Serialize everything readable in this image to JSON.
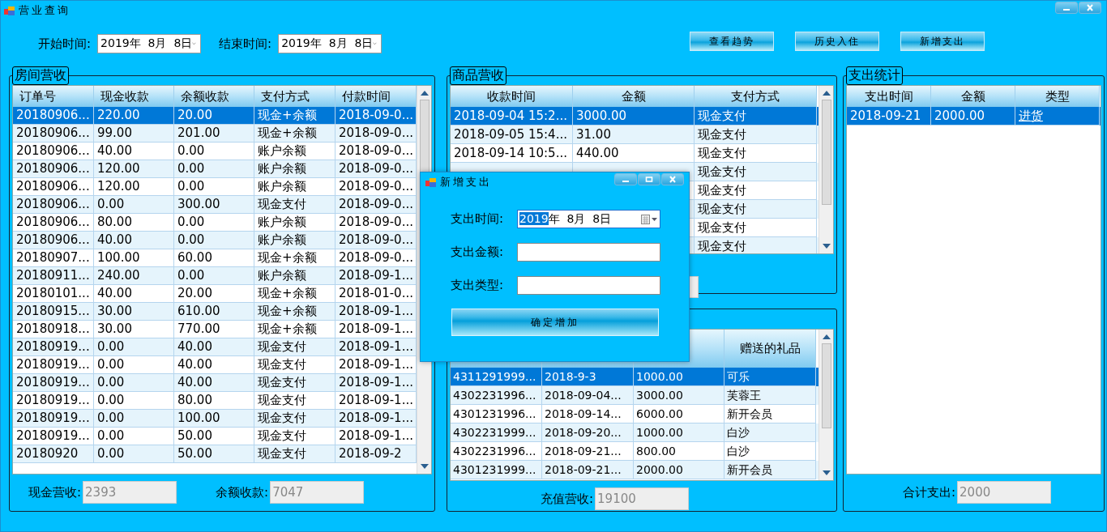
{
  "window": {
    "title": "营业查询"
  },
  "filters": [
    {
      "label": "开始时间:",
      "value": "2019年  8月  8日"
    },
    {
      "label": "结束时间:",
      "value": "2019年  8月  8日"
    }
  ],
  "buttons": [
    "查看趋势",
    "历史入住",
    "新增支出"
  ],
  "room_revenue": {
    "title": "房间营收",
    "columns": [
      "订单号",
      "现金收款",
      "余额收款",
      "支付方式",
      "付款时间"
    ],
    "rows": [
      {
        "cells": [
          "20180906...",
          "220.00",
          "20.00",
          "现金+余额",
          "2018-09-0..."
        ],
        "selected": true
      },
      {
        "cells": [
          "20180906...",
          "99.00",
          "201.00",
          "现金+余额",
          "2018-09-0..."
        ],
        "selected": false
      },
      {
        "cells": [
          "20180906...",
          "40.00",
          "0.00",
          "账户余额",
          "2018-09-0..."
        ],
        "selected": false
      },
      {
        "cells": [
          "20180906...",
          "120.00",
          "0.00",
          "账户余额",
          "2018-09-0..."
        ],
        "selected": false
      },
      {
        "cells": [
          "20180906...",
          "120.00",
          "0.00",
          "账户余额",
          "2018-09-0..."
        ],
        "selected": false
      },
      {
        "cells": [
          "20180906...",
          "0.00",
          "300.00",
          "现金支付",
          "2018-09-0..."
        ],
        "selected": false
      },
      {
        "cells": [
          "20180906...",
          "80.00",
          "0.00",
          "账户余额",
          "2018-09-0..."
        ],
        "selected": false
      },
      {
        "cells": [
          "20180906...",
          "40.00",
          "0.00",
          "账户余额",
          "2018-09-0..."
        ],
        "selected": false
      },
      {
        "cells": [
          "20180907...",
          "100.00",
          "60.00",
          "现金+余额",
          "2018-09-0..."
        ],
        "selected": false
      },
      {
        "cells": [
          "20180911...",
          "240.00",
          "0.00",
          "账户余额",
          "2018-09-1..."
        ],
        "selected": false
      },
      {
        "cells": [
          "20180101...",
          "40.00",
          "20.00",
          "现金+余额",
          "2018-01-0..."
        ],
        "selected": false
      },
      {
        "cells": [
          "20180915...",
          "30.00",
          "610.00",
          "现金+余额",
          "2018-09-1..."
        ],
        "selected": false
      },
      {
        "cells": [
          "20180918...",
          "30.00",
          "770.00",
          "现金+余额",
          "2018-09-1..."
        ],
        "selected": false
      },
      {
        "cells": [
          "20180919...",
          "0.00",
          "40.00",
          "现金支付",
          "2018-09-1..."
        ],
        "selected": false
      },
      {
        "cells": [
          "20180919...",
          "0.00",
          "40.00",
          "现金支付",
          "2018-09-1..."
        ],
        "selected": false
      },
      {
        "cells": [
          "20180919...",
          "0.00",
          "40.00",
          "现金支付",
          "2018-09-1..."
        ],
        "selected": false
      },
      {
        "cells": [
          "20180919...",
          "0.00",
          "80.00",
          "现金支付",
          "2018-09-1..."
        ],
        "selected": false
      },
      {
        "cells": [
          "20180919...",
          "0.00",
          "100.00",
          "现金支付",
          "2018-09-1..."
        ],
        "selected": false
      },
      {
        "cells": [
          "20180919...",
          "0.00",
          "50.00",
          "现金支付",
          "2018-09-1..."
        ],
        "selected": false
      },
      {
        "cells": [
          "20180920",
          "0.00",
          "50.00",
          "现金支付",
          "2018-09-2"
        ],
        "selected": false
      }
    ],
    "totals": [
      {
        "label": "现金营收:",
        "value": "2393"
      },
      {
        "label": "余额收款:",
        "value": "7047"
      }
    ]
  },
  "goods_revenue": {
    "title": "商品营收",
    "columns": [
      "收款时间",
      "金额",
      "支付方式"
    ],
    "rows": [
      {
        "cells": [
          "2018-09-04 15:2...",
          "3000.00",
          "现金支付"
        ],
        "selected": true
      },
      {
        "cells": [
          "2018-09-05 15:4...",
          "31.00",
          "现金支付"
        ],
        "selected": false
      },
      {
        "cells": [
          "2018-09-14 10:5...",
          "440.00",
          "现金支付"
        ],
        "selected": false
      },
      {
        "cells": [
          "现金支付"
        ],
        "selected": false
      },
      {
        "cells": [
          "现金支付"
        ],
        "selected": false
      },
      {
        "cells": [
          "现金支付"
        ],
        "selected": false
      },
      {
        "cells": [
          "现金支付"
        ],
        "selected": false
      },
      {
        "cells": [
          "现金支付"
        ],
        "selected": false
      }
    ]
  },
  "recharge": {
    "column_4": "赠送的礼品",
    "rows": [
      {
        "cells": [
          "4311291999...",
          "2018-9-3",
          "1000.00",
          "可乐"
        ],
        "selected": true
      },
      {
        "cells": [
          "4302231996...",
          "2018-09-04...",
          "3000.00",
          "芙蓉王"
        ],
        "selected": false
      },
      {
        "cells": [
          "4301231996...",
          "2018-09-14...",
          "6000.00",
          "新开会员"
        ],
        "selected": false
      },
      {
        "cells": [
          "4302231999...",
          "2018-09-20...",
          "1000.00",
          "白沙"
        ],
        "selected": false
      },
      {
        "cells": [
          "4302231996...",
          "2018-09-21...",
          "800.00",
          "白沙"
        ],
        "selected": false
      },
      {
        "cells": [
          "4301231999...",
          "2018-09-21...",
          "2000.00",
          "新开会员"
        ],
        "selected": false
      }
    ],
    "totals": [
      {
        "label": "充值营收:",
        "value": "19100"
      }
    ]
  },
  "expenses": {
    "title": "支出统计",
    "columns": [
      "支出时间",
      "金额",
      "类型"
    ],
    "rows": [
      {
        "cells": [
          "2018-09-21",
          "2000.00",
          "进货"
        ],
        "selected": true
      }
    ],
    "totals": [
      {
        "label": "合计支出:",
        "value": "2000"
      }
    ]
  },
  "dialog": {
    "title": "新增支出",
    "fields": [
      {
        "kind": "date",
        "label": "支出时间:",
        "selected_text": "2019",
        "value": "年  8月  8日"
      },
      {
        "kind": "text",
        "label": "支出金额:"
      },
      {
        "kind": "text",
        "label": "支出类型:"
      }
    ],
    "button": "确定增加"
  }
}
